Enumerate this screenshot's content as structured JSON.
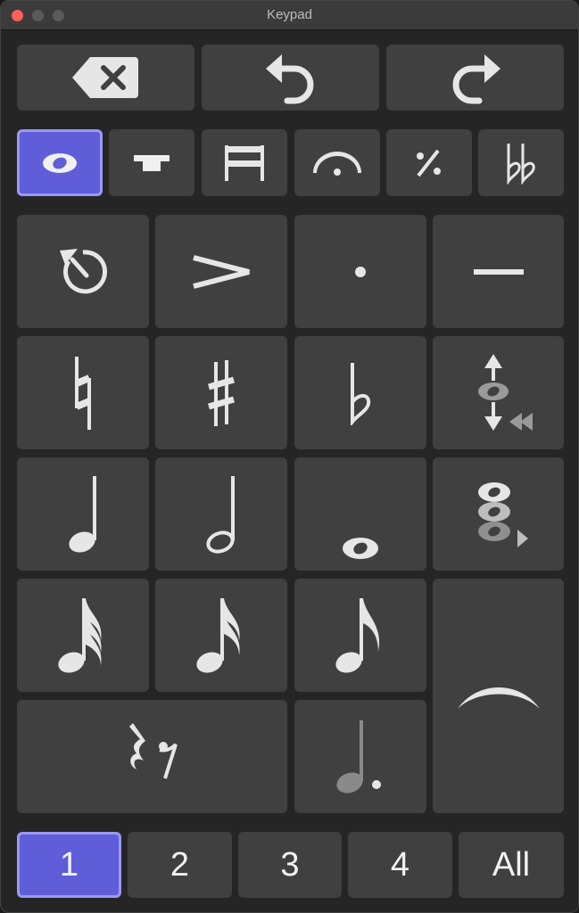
{
  "window": {
    "title": "Keypad"
  },
  "top_row": {
    "items": [
      "delete-icon",
      "undo-icon",
      "redo-icon"
    ]
  },
  "mode_tabs": {
    "items": [
      "notes-icon",
      "tenuto-bar-icon",
      "bars-icon",
      "fermata-icon",
      "repeat-icon",
      "double-flat-icon"
    ],
    "selected_index": 0
  },
  "keypad": {
    "items": [
      "rest-reset-icon",
      "accent-icon",
      "staccato-icon",
      "tenuto-icon",
      "natural-icon",
      "sharp-icon",
      "flat-icon",
      "enharmonic-icon",
      "quarter-note-icon",
      "half-note-icon",
      "whole-note-icon",
      "chord-icon",
      "sixteenth-note-icon",
      "thirty-second-note-icon",
      "eighth-note-icon",
      "tie-icon",
      "rests-icon",
      "dotted-note-icon"
    ]
  },
  "layouts": {
    "labels": [
      "1",
      "2",
      "3",
      "4",
      "All"
    ],
    "selected_index": 0
  },
  "colors": {
    "accent": "#5f5ed8",
    "accent_border": "#9a99f4",
    "button": "#404040",
    "background": "#252525"
  }
}
